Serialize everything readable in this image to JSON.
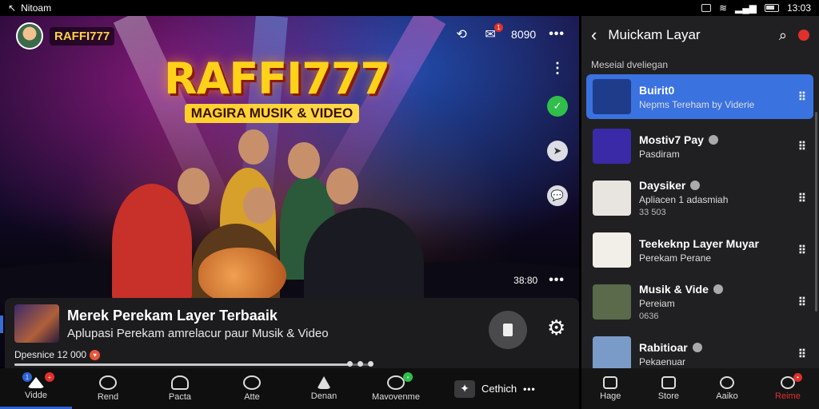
{
  "status_bar": {
    "carrier": "Nitoam",
    "time": "13:03"
  },
  "player": {
    "channel_name": "RAFFI777",
    "logo_text": "RAFFI777",
    "logo_subtitle": "MAGIRA MUSIK & VIDEO",
    "top_count": "8090",
    "notif_count": "1",
    "time_display": "38:80"
  },
  "video_info": {
    "title": "Merek Perekam Layer Terbaaik",
    "description": "Aplupasi Perekam amrelacur paur Musik & Video",
    "meta": "Dpesnice 12 000"
  },
  "bottom_nav": {
    "items": [
      {
        "label": "Vidde",
        "icon": "home-icon",
        "active": true
      },
      {
        "label": "Rend",
        "icon": "record-icon"
      },
      {
        "label": "Pacta",
        "icon": "person-icon"
      },
      {
        "label": "Atte",
        "icon": "chat-icon"
      },
      {
        "label": "Denan",
        "icon": "music-icon"
      },
      {
        "label": "Mavovenme",
        "icon": "people-icon"
      }
    ],
    "cta_label": "Cethich"
  },
  "panel": {
    "title": "Muickam Layar",
    "section_label": "Meseial dveliegan",
    "items": [
      {
        "title": "Buirit0",
        "subtitle": "Nepms Tereham by Viderie",
        "meta": "",
        "active": true,
        "thumb": "#1e3c8a"
      },
      {
        "title": "Mostiv7 Pay",
        "subtitle": "Pasdiram",
        "meta": "",
        "active": false,
        "thumb": "#3a2aa8"
      },
      {
        "title": "Daysiker",
        "subtitle": "Apliacen 1 adasmiah",
        "meta": "33 503",
        "active": false,
        "thumb": "#e8e4e0"
      },
      {
        "title": "Teekeknp Layer Muyar",
        "subtitle": "Perekam Perane",
        "meta": "",
        "active": false,
        "thumb": "#f2efe8"
      },
      {
        "title": "Musik & Vide",
        "subtitle": "Pereiam",
        "meta": "0636",
        "active": false,
        "thumb": "#5a6a4a"
      },
      {
        "title": "Rabitioar",
        "subtitle": "Pekaenuar",
        "meta": "",
        "active": false,
        "thumb": "#7a9ac8"
      }
    ],
    "nav": [
      {
        "label": "Hage",
        "active": false
      },
      {
        "label": "Store",
        "active": false
      },
      {
        "label": "Aaiko",
        "active": false
      },
      {
        "label": "Reime",
        "active": true
      }
    ]
  }
}
